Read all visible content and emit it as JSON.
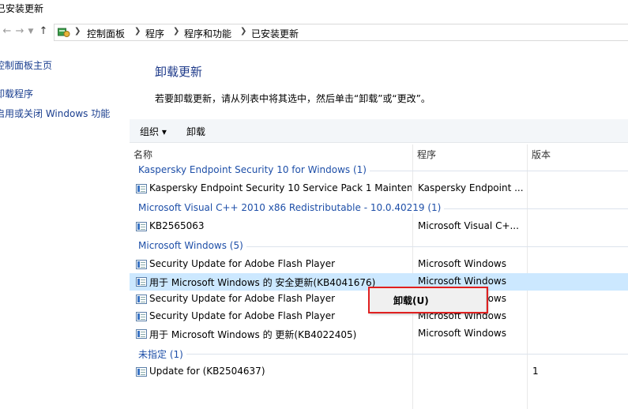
{
  "window": {
    "title": "已安装更新"
  },
  "nav": {
    "back_icon": "arrow-left",
    "forward_icon": "arrow-right",
    "dropdown_icon": "chevron-down",
    "up_icon": "arrow-up",
    "address_icon": "control-panel-icon",
    "breadcrumbs": [
      "控制面板",
      "程序",
      "程序和功能",
      "已安装更新"
    ]
  },
  "sidebar": {
    "items": [
      "控制面板主页",
      "卸载程序",
      "启用或关闭 Windows 功能"
    ]
  },
  "main": {
    "heading": "卸载更新",
    "instructions": "若要卸载更新，请从列表中将其选中，然后单击“卸载”或“更改”。"
  },
  "toolbar": {
    "organize": "组织 ▾",
    "uninstall": "卸载"
  },
  "table": {
    "columns": [
      "名称",
      "程序",
      "版本"
    ],
    "groups": [
      {
        "label": "Kaspersky Endpoint Security 10 for Windows (1)",
        "rows": [
          {
            "name": "Kaspersky Endpoint Security 10 Service Pack 1 Mainten...",
            "program": "Kaspersky Endpoint ...",
            "version": ""
          }
        ]
      },
      {
        "label": "Microsoft Visual C++ 2010  x86 Redistributable - 10.0.40219 (1)",
        "rows": [
          {
            "name": "KB2565063",
            "program": "Microsoft Visual C+...",
            "version": ""
          }
        ]
      },
      {
        "label": "Microsoft Windows (5)",
        "rows": [
          {
            "name": "Security Update for Adobe Flash Player",
            "program": "Microsoft Windows",
            "version": ""
          },
          {
            "name": "用于 Microsoft Windows 的 安全更新(KB4041676)",
            "program": "Microsoft Windows",
            "version": "",
            "selected": true
          },
          {
            "name": "Security Update for Adobe Flash Player",
            "program": "Microsoft Windows",
            "version": ""
          },
          {
            "name": "Security Update for Adobe Flash Player",
            "program": "Microsoft Windows",
            "version": ""
          },
          {
            "name": "用于 Microsoft Windows 的 更新(KB4022405)",
            "program": "Microsoft Windows",
            "version": ""
          }
        ]
      },
      {
        "label": "未指定 (1)",
        "rows": [
          {
            "name": "Update for  (KB2504637)",
            "program": "",
            "version": "1"
          }
        ]
      }
    ]
  },
  "context_menu": {
    "uninstall": "卸载(U)"
  },
  "colors": {
    "link": "#1a3e8f",
    "group": "#1e4fa8",
    "selected_row": "#cce8ff",
    "highlight": "#e02020"
  }
}
